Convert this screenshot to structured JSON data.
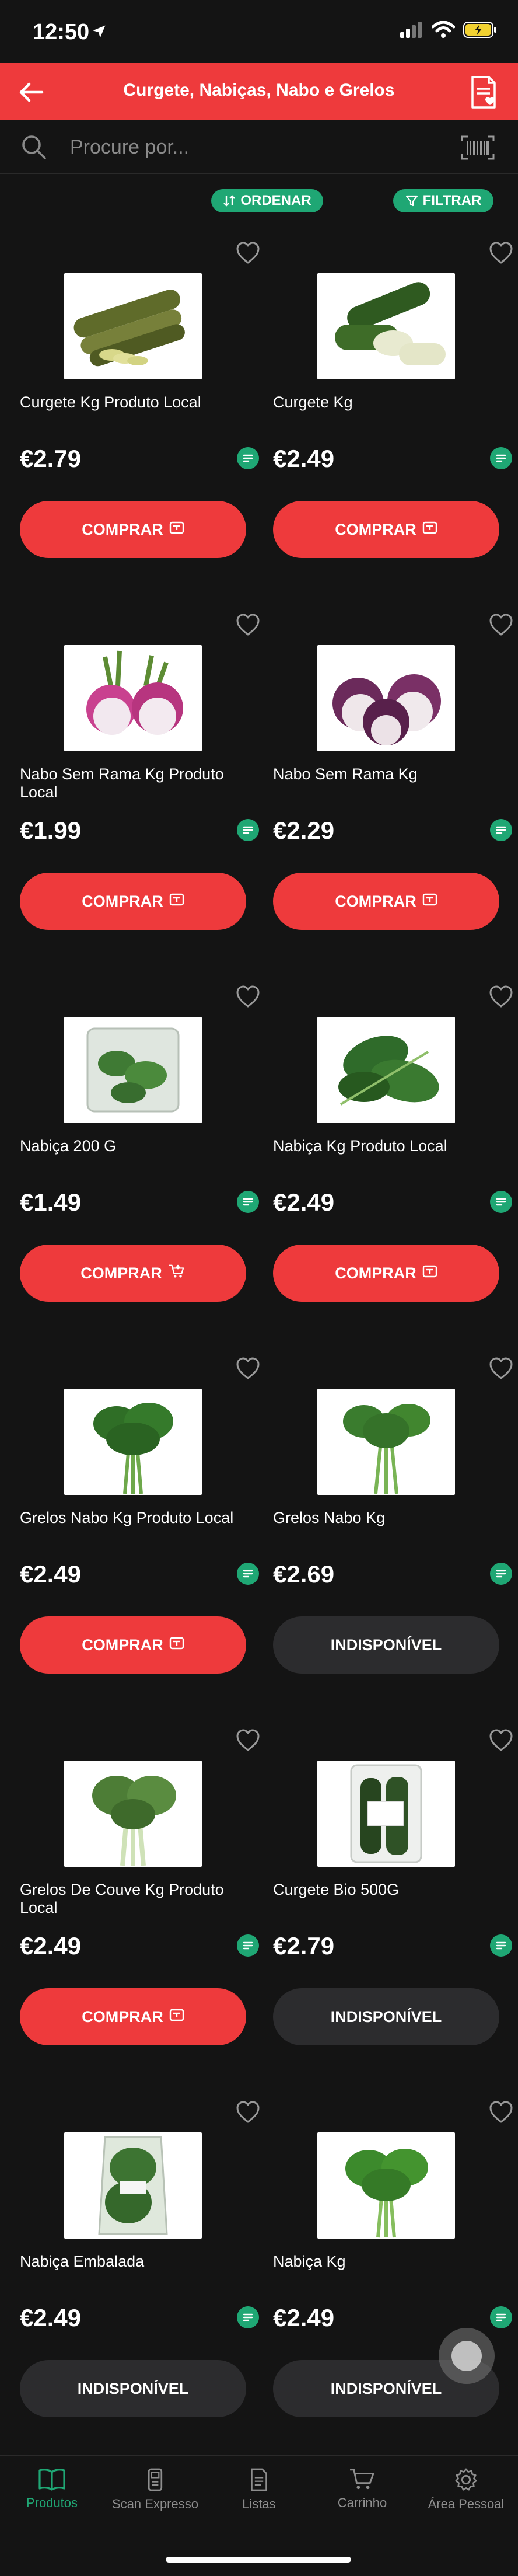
{
  "status": {
    "time": "12:50"
  },
  "header": {
    "title": "Curgete, Nabiças, Nabo e Grelos"
  },
  "search": {
    "placeholder": "Procure por..."
  },
  "filters": {
    "order_label": "ORDENAR",
    "filter_label": "FILTRAR"
  },
  "products": [
    {
      "name": "Curgete Kg Produto Local",
      "price": "€2.79",
      "button": "COMPRAR",
      "available": true,
      "image": "zucchini-sliced"
    },
    {
      "name": "Curgete Kg",
      "price": "€2.49",
      "button": "COMPRAR",
      "available": true,
      "image": "zucchini-halved"
    },
    {
      "name": "Nabo Sem Rama Kg Produto Local",
      "price": "€1.99",
      "button": "COMPRAR",
      "available": true,
      "image": "turnip-pink"
    },
    {
      "name": "Nabo Sem Rama Kg",
      "price": "€2.29",
      "button": "COMPRAR",
      "available": true,
      "image": "turnip-purple"
    },
    {
      "name": "Nabiça 200 G",
      "price": "€1.49",
      "button": "COMPRAR",
      "available": true,
      "image": "greens-bag"
    },
    {
      "name": "Nabiça Kg Produto Local",
      "price": "€2.49",
      "button": "COMPRAR",
      "available": true,
      "image": "greens-leaves"
    },
    {
      "name": "Grelos Nabo Kg Produto Local",
      "price": "€2.49",
      "button": "COMPRAR",
      "available": true,
      "image": "grelos-bunch"
    },
    {
      "name": "Grelos Nabo Kg",
      "price": "€2.69",
      "button": "INDISPONÍVEL",
      "available": false,
      "image": "grelos-bunch-2"
    },
    {
      "name": "Grelos De Couve Kg Produto Local",
      "price": "€2.49",
      "button": "COMPRAR",
      "available": true,
      "image": "cabbage-greens"
    },
    {
      "name": "Curgete Bio 500G",
      "price": "€2.79",
      "button": "INDISPONÍVEL",
      "available": false,
      "image": "zucchini-pack"
    },
    {
      "name": "Nabiça Embalada",
      "price": "€2.49",
      "button": "INDISPONÍVEL",
      "available": false,
      "image": "greens-packed"
    },
    {
      "name": "Nabiça Kg",
      "price": "€2.49",
      "button": "INDISPONÍVEL",
      "available": false,
      "image": "greens-bunch"
    }
  ],
  "tabs": [
    {
      "label": "Produtos",
      "icon": "book-icon",
      "active": true
    },
    {
      "label": "Scan Expresso",
      "icon": "scanner-icon",
      "active": false
    },
    {
      "label": "Listas",
      "icon": "list-icon",
      "active": false
    },
    {
      "label": "Carrinho",
      "icon": "cart-icon",
      "active": false
    },
    {
      "label": "Área Pessoal",
      "icon": "gear-icon",
      "active": false
    }
  ],
  "colors": {
    "brand_red": "#ee3a3c",
    "promo_green": "#1fa774",
    "background": "#141414",
    "disabled_button": "#2c2c2e"
  }
}
